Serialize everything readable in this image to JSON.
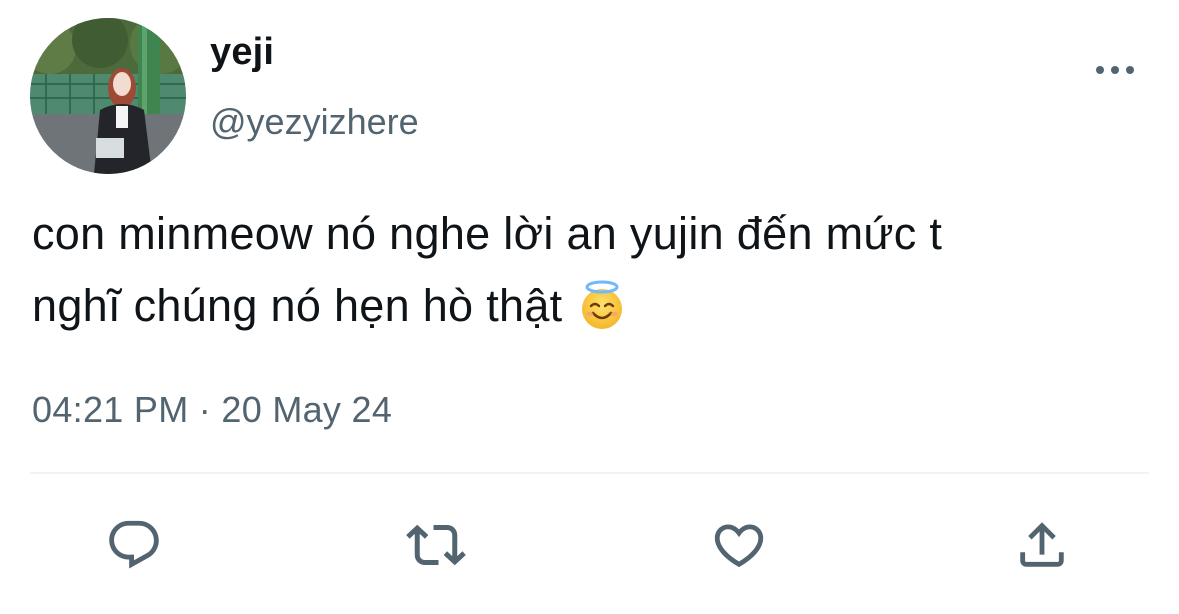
{
  "tweet": {
    "author": {
      "display_name": "yeji",
      "handle": "@yezyizhere",
      "avatar_icon": "profile-photo"
    },
    "more_icon": "more-horizontal-icon",
    "text_lines": [
      "con minmeow nó nghe lời an yujin đến mức t",
      "nghĩ chúng nó hẹn hò thật"
    ],
    "emoji": "smiling-face-with-halo",
    "timestamp": "04:21 PM · 20 May 24"
  },
  "actions": {
    "reply_icon": "reply-icon",
    "retweet_icon": "retweet-icon",
    "like_icon": "heart-icon",
    "share_icon": "share-icon"
  },
  "colors": {
    "text_primary": "#0f1419",
    "text_secondary": "#536471",
    "divider": "#eff3f4",
    "icon_gray": "#536471"
  }
}
